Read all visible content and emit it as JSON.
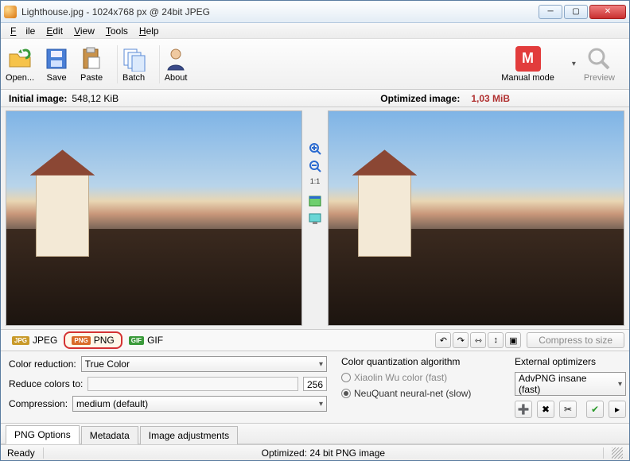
{
  "titlebar": {
    "text": "Lighthouse.jpg - 1024x768 px @ 24bit JPEG"
  },
  "menu": {
    "file": "File",
    "edit": "Edit",
    "view": "View",
    "tools": "Tools",
    "help": "Help"
  },
  "toolbar": {
    "open": "Open...",
    "save": "Save",
    "paste": "Paste",
    "batch": "Batch",
    "about": "About",
    "manual": "Manual mode",
    "preview": "Preview"
  },
  "sizes": {
    "initial_label": "Initial image:",
    "initial_value": "548,12 KiB",
    "optimized_label": "Optimized image:",
    "optimized_value": "1,03 MiB"
  },
  "midtools": {
    "ratio": "1:1"
  },
  "formats": {
    "jpeg": "JPEG",
    "png": "PNG",
    "gif": "GIF",
    "compress_to_size": "Compress to size"
  },
  "options": {
    "color_reduction_label": "Color reduction:",
    "color_reduction_value": "True Color",
    "reduce_colors_label": "Reduce colors to:",
    "reduce_colors_value": "256",
    "compression_label": "Compression:",
    "compression_value": "medium (default)",
    "quant_title": "Color quantization algorithm",
    "quant_opt1": "Xiaolin Wu color (fast)",
    "quant_opt2": "NeuQuant neural-net (slow)",
    "ext_title": "External optimizers",
    "ext_value": "AdvPNG insane (fast)"
  },
  "bottom_tabs": {
    "png": "PNG Options",
    "meta": "Metadata",
    "adj": "Image adjustments"
  },
  "status": {
    "ready": "Ready",
    "info": "Optimized: 24 bit PNG image"
  }
}
